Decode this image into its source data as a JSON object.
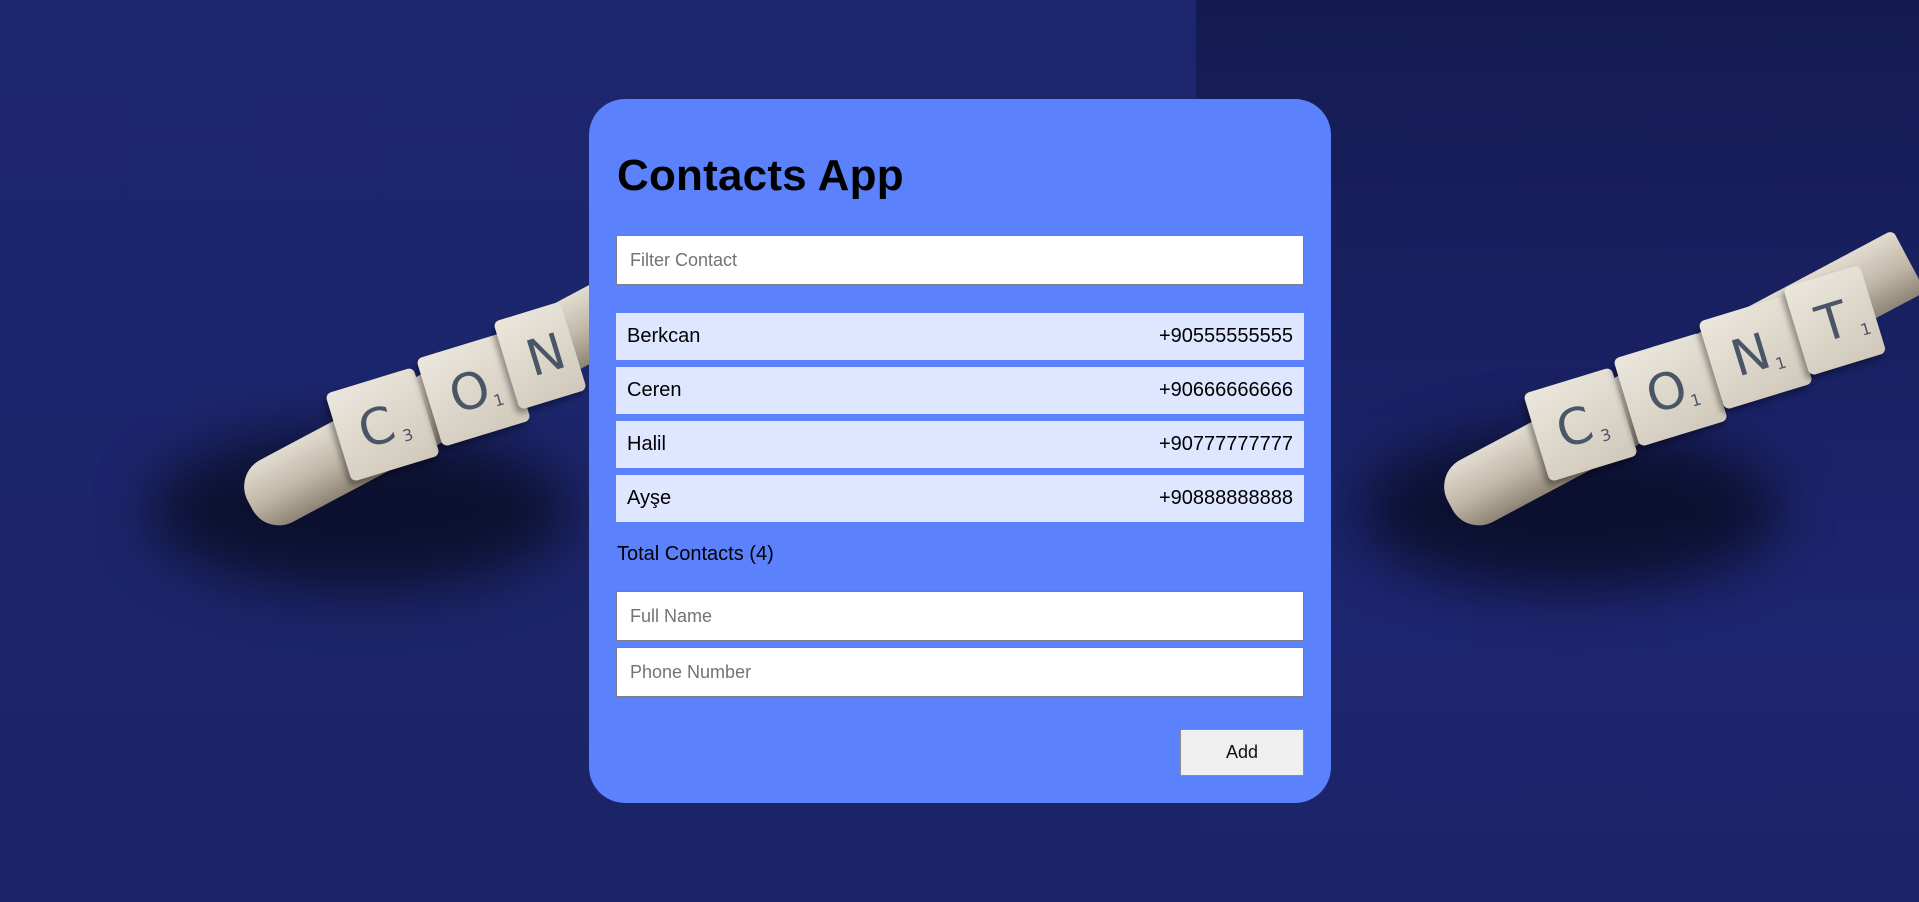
{
  "app": {
    "title": "Contacts App"
  },
  "filter": {
    "placeholder": "Filter Contact",
    "value": ""
  },
  "contacts": [
    {
      "name": "Berkcan",
      "phone": "+90555555555"
    },
    {
      "name": "Ceren",
      "phone": "+90666666666"
    },
    {
      "name": "Halil",
      "phone": "+90777777777"
    },
    {
      "name": "Ayşe",
      "phone": "+90888888888"
    }
  ],
  "summary": {
    "total_label": "Total Contacts (4)"
  },
  "form": {
    "fullname_placeholder": "Full Name",
    "phone_placeholder": "Phone Number",
    "add_label": "Add"
  },
  "colors": {
    "card": "#5c81fc",
    "contact_row": "#dfe6ff",
    "background": "#1c2569"
  }
}
